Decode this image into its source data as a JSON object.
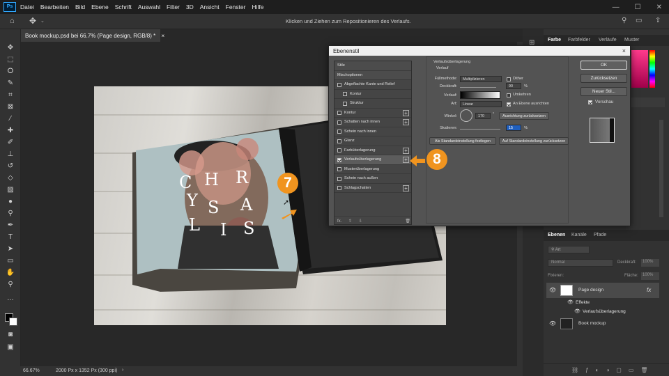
{
  "app": {
    "logo": "Ps"
  },
  "menu": [
    "Datei",
    "Bearbeiten",
    "Bild",
    "Ebene",
    "Schrift",
    "Auswahl",
    "Filter",
    "3D",
    "Ansicht",
    "Fenster",
    "Hilfe"
  ],
  "options_bar": {
    "hint": "Klicken und Ziehen zum Repositionieren des Verlaufs."
  },
  "document_tab": {
    "title": "Book mockup.psd bei 66.7% (Page design, RGB/8) *",
    "close": "×"
  },
  "status": {
    "zoom": "66.67%",
    "doc_info": "2000 Px x 1352 Px (300 ppi)",
    "arrow": "›"
  },
  "panel_tabs_top": [
    "Farbe",
    "Farbfelder",
    "Verläufe",
    "Muster"
  ],
  "panel_tabs_layers": [
    "Ebenen",
    "Kanäle",
    "Pfade"
  ],
  "layers_panel": {
    "kind_placeholder": "Art",
    "blend": "Normal",
    "opacity_label": "Deckkraft:",
    "opacity": "100%",
    "lock_label": "Fixieren:",
    "fill_label": "Fläche:",
    "fill": "100%",
    "layers": [
      {
        "name": "Page design",
        "fx": "fx"
      },
      {
        "name": "Effekte"
      },
      {
        "name": "Verlaufsüberlagerung"
      },
      {
        "name": "Book mockup"
      }
    ]
  },
  "dialog": {
    "title": "Ebenenstil",
    "close": "×",
    "styles_list": [
      {
        "label": "Stile",
        "type": "header"
      },
      {
        "label": "Mischoptionen",
        "type": "header"
      },
      {
        "label": "Abgeflachte Kante und Relief",
        "checked": false
      },
      {
        "label": "Kontur",
        "checked": false,
        "indent": true
      },
      {
        "label": "Struktur",
        "checked": false,
        "indent": true
      },
      {
        "label": "Kontur",
        "checked": false,
        "plus": true
      },
      {
        "label": "Schatten nach innen",
        "checked": false,
        "plus": true
      },
      {
        "label": "Schein nach innen",
        "checked": false
      },
      {
        "label": "Glanz",
        "checked": false
      },
      {
        "label": "Farbüberlagerung",
        "checked": false,
        "plus": true
      },
      {
        "label": "Verlaufsüberlagerung",
        "checked": true,
        "plus": true,
        "selected": true
      },
      {
        "label": "Musterüberlagerung",
        "checked": false
      },
      {
        "label": "Schein nach außen",
        "checked": false
      },
      {
        "label": "Schlagschatten",
        "checked": false,
        "plus": true
      }
    ],
    "footer_fx": "fx.",
    "section_title": "Verlaufsüberlagerung",
    "subsection": "Verlauf",
    "blend_mode_label": "Füllmethode:",
    "blend_mode": "Multiplizieren",
    "dither_label": "Dither",
    "opacity_label": "Deckkraft:",
    "opacity": "90",
    "gradient_label": "Verlauf:",
    "reverse_label": "Umkehren",
    "style_label": "Art:",
    "style": "Linear",
    "align_label": "An Ebene ausrichten",
    "angle_label": "Winkel:",
    "angle": "170",
    "reset_align_button": "Ausrichtung zurücksetzen",
    "scale_label": "Skalieren:",
    "scale": "15",
    "percent": "%",
    "degree": "°",
    "set_default_button": "Als Standardeinstellung festlegen",
    "reset_default_button": "Auf Standardeinstellung zurücksetzen",
    "ok": "OK",
    "cancel": "Zurücksetzen",
    "new_style": "Neuer Stil...",
    "preview_label": "Vorschau"
  },
  "artwork": {
    "letters": [
      "C",
      "H",
      "R",
      "Y",
      "S",
      "A",
      "L",
      "I",
      "S"
    ]
  },
  "callouts": {
    "seven": "7",
    "eight": "8"
  },
  "colors": {
    "accent": "#f0941f",
    "ui_dark": "#323232",
    "selected_row": "#5c5c5c"
  }
}
